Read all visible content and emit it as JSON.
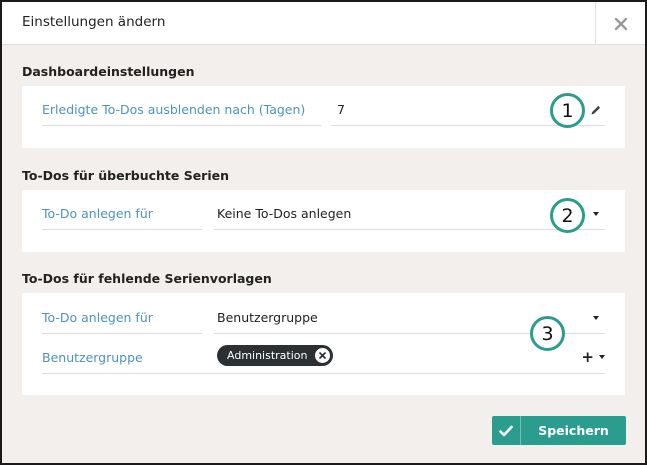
{
  "dialog": {
    "title": "Einstellungen ändern"
  },
  "sections": {
    "dashboard": {
      "title": "Dashboardeinstellungen",
      "hide_done_label": "Erledigte To-Dos ausblenden nach (Tagen)",
      "hide_done_value": "7"
    },
    "overbooked": {
      "title": "To-Dos für überbuchte Serien",
      "create_for_label": "To-Do anlegen für",
      "create_for_value": "Keine To-Dos anlegen"
    },
    "missing_templates": {
      "title": "To-Dos für fehlende Serienvorlagen",
      "create_for_label": "To-Do anlegen für",
      "create_for_value": "Benutzergruppe",
      "group_label": "Benutzergruppe",
      "group_chip": "Administration"
    }
  },
  "markers": {
    "one": "1",
    "two": "2",
    "three": "3"
  },
  "footer": {
    "save_label": "Speichern"
  },
  "colors": {
    "accent": "#2a9d8f",
    "label": "#4c93bd",
    "chip_bg": "#2b3033",
    "background": "#f2efed"
  }
}
